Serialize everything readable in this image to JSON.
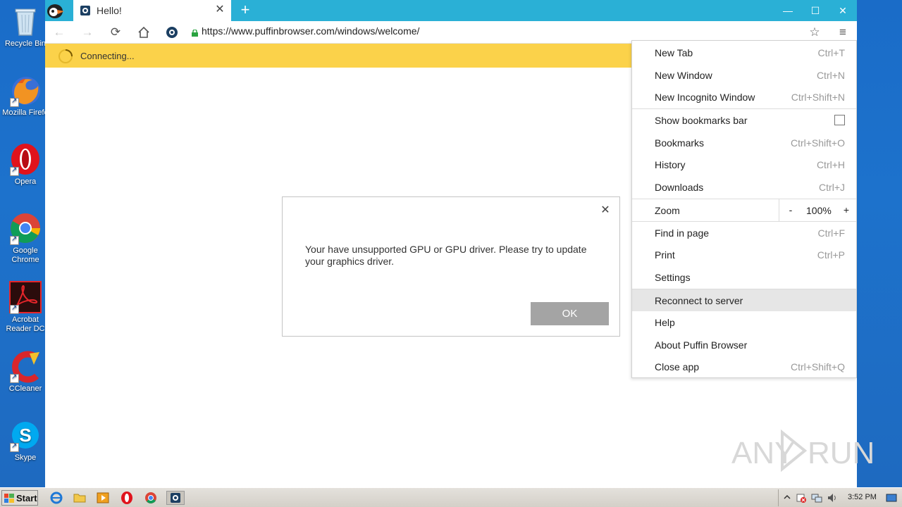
{
  "desktop": {
    "icons": [
      {
        "label_1": "Recycle Bin",
        "label_2": ""
      },
      {
        "label_1": "Mozilla Firefo",
        "label_2": ""
      },
      {
        "label_1": "Opera",
        "label_2": ""
      },
      {
        "label_1": "Google",
        "label_2": "Chrome"
      },
      {
        "label_1": "Acrobat",
        "label_2": "Reader DC"
      },
      {
        "label_1": "CCleaner",
        "label_2": ""
      },
      {
        "label_1": "Skype",
        "label_2": ""
      }
    ]
  },
  "browser": {
    "tab_title": "Hello!",
    "url": "https://www.puffinbrowser.com/windows/welcome/",
    "status_text": "Connecting...",
    "accent_color": "#2ab0d6",
    "infobar_color": "#fbd24a"
  },
  "dialog": {
    "message": "Your have unsupported GPU or GPU driver. Please try to update your graphics driver.",
    "ok_label": "OK"
  },
  "menu": {
    "items": [
      {
        "label": "New Tab",
        "shortcut": "Ctrl+T"
      },
      {
        "label": "New Window",
        "shortcut": "Ctrl+N"
      },
      {
        "label": "New Incognito Window",
        "shortcut": "Ctrl+Shift+N"
      },
      {
        "label": "Show bookmarks bar",
        "shortcut": ""
      },
      {
        "label": "Bookmarks",
        "shortcut": "Ctrl+Shift+O"
      },
      {
        "label": "History",
        "shortcut": "Ctrl+H"
      },
      {
        "label": "Downloads",
        "shortcut": "Ctrl+J"
      },
      {
        "label": "Zoom",
        "shortcut": ""
      },
      {
        "label": "Find in page",
        "shortcut": "Ctrl+F"
      },
      {
        "label": "Print",
        "shortcut": "Ctrl+P"
      },
      {
        "label": "Settings",
        "shortcut": ""
      },
      {
        "label": "Reconnect to server",
        "shortcut": ""
      },
      {
        "label": "Help",
        "shortcut": ""
      },
      {
        "label": "About Puffin Browser",
        "shortcut": ""
      },
      {
        "label": "Close app",
        "shortcut": "Ctrl+Shift+Q"
      }
    ],
    "zoom": {
      "minus": "-",
      "value": "100%",
      "plus": "+"
    },
    "bookmarks_bar_checked": false,
    "highlighted_item": "Reconnect to server"
  },
  "watermark": {
    "text_left": "ANY",
    "text_right": "RUN"
  },
  "taskbar": {
    "start_label": "Start",
    "clock": "3:52 PM"
  }
}
